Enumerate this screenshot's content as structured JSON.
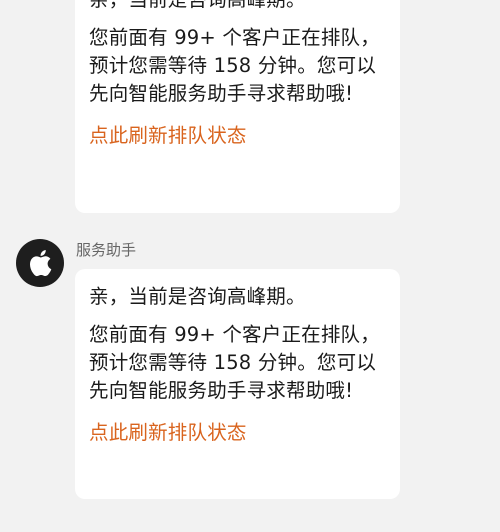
{
  "messages": [
    {
      "greeting": "亲，当前是咨询高峰期。",
      "queue_text": "您前面有 99+ 个客户正在排队，预计您需等待 158 分钟。您可以先向智能服务助手寻求帮助哦!",
      "refresh_link": "点此刷新排队状态"
    },
    {
      "sender": "服务助手",
      "avatar_icon": "apple-logo-icon",
      "greeting": "亲，当前是咨询高峰期。",
      "queue_text": "您前面有 99+ 个客户正在排队，预计您需等待 158 分钟。您可以先向智能服务助手寻求帮助哦!",
      "refresh_link": "点此刷新排队状态"
    }
  ],
  "colors": {
    "background": "#f2f2f2",
    "bubble": "#ffffff",
    "link": "#d9641e",
    "avatar": "#1e1e1e"
  }
}
